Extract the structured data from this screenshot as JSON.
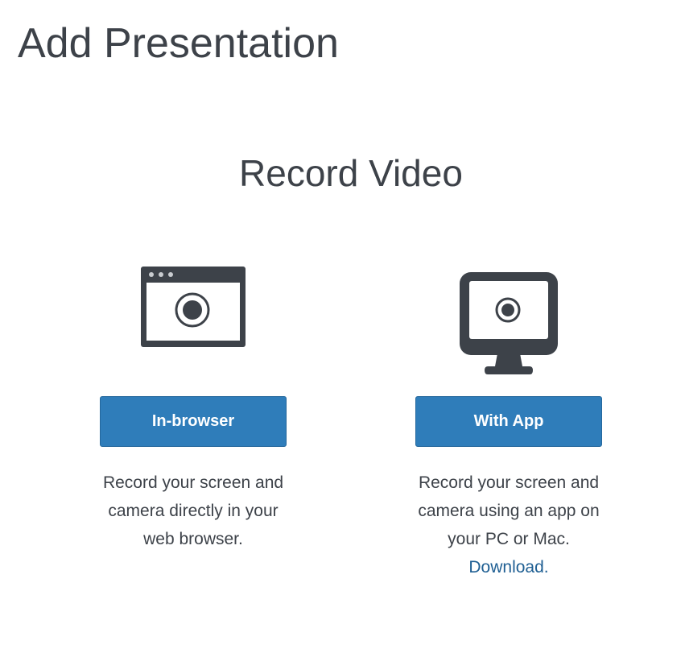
{
  "page": {
    "title": "Add Presentation"
  },
  "section": {
    "title": "Record Video"
  },
  "options": [
    {
      "icon": "browser-window-record-icon",
      "button_label": "In-browser",
      "description_lines": [
        "Record your screen and",
        "camera directly in your",
        "web browser."
      ]
    },
    {
      "icon": "desktop-monitor-record-icon",
      "button_label": "With App",
      "description_lines": [
        "Record your screen and",
        "camera using an app on",
        "your PC or Mac."
      ],
      "link_label": "Download."
    }
  ],
  "colors": {
    "text": "#3d4249",
    "button": "#2f7dba",
    "link": "#1f5f93",
    "icon": "#3d4249"
  }
}
